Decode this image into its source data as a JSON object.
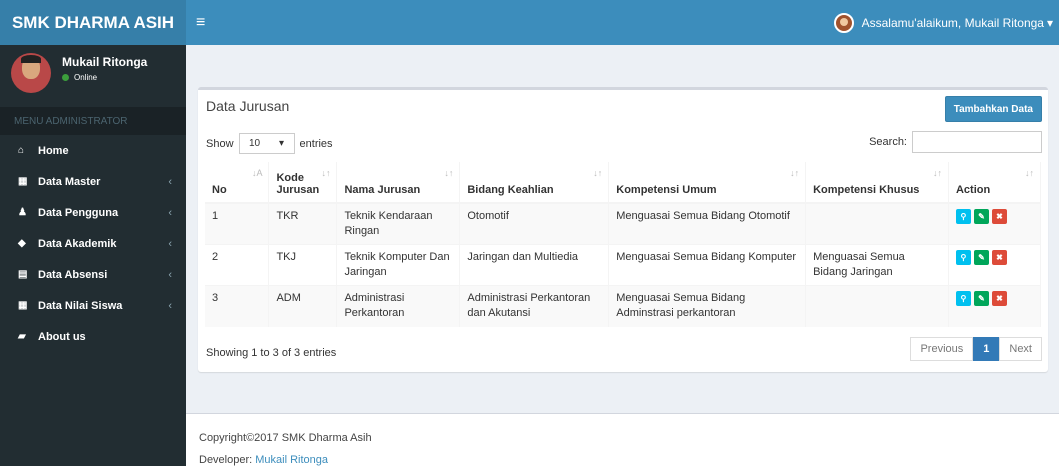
{
  "brand": "SMK DHARMA ASIH",
  "header": {
    "menu_icon": "hamburger-icon",
    "greeting": "Assalamu'alaikum, Mukail Ritonga",
    "caret": "▾"
  },
  "user": {
    "name": "Mukail Ritonga",
    "status": "Online"
  },
  "sidebar": {
    "header": "MENU ADMINISTRATOR",
    "items": [
      {
        "label": "Home",
        "icon": "home-icon",
        "glyph": "⌂",
        "chevron": ""
      },
      {
        "label": "Data Master",
        "icon": "grid-icon",
        "glyph": "▦",
        "chevron": "‹"
      },
      {
        "label": "Data Pengguna",
        "icon": "user-icon",
        "glyph": "♟",
        "chevron": "‹"
      },
      {
        "label": "Data Akademik",
        "icon": "tag-icon",
        "glyph": "◆",
        "chevron": "‹"
      },
      {
        "label": "Data Absensi",
        "icon": "calendar-icon",
        "glyph": "▤",
        "chevron": "‹"
      },
      {
        "label": "Data Nilai Siswa",
        "icon": "table-icon",
        "glyph": "▦",
        "chevron": "‹"
      },
      {
        "label": "About us",
        "icon": "book-icon",
        "glyph": "▰",
        "chevron": ""
      }
    ]
  },
  "box": {
    "title": "Data Jurusan",
    "add_button": "Tambahkan Data"
  },
  "table_controls": {
    "show": "Show",
    "length": "10",
    "entries": "entries",
    "search": "Search:"
  },
  "columns": [
    "No",
    "Kode Jurusan",
    "Nama Jurusan",
    "Bidang Keahlian",
    "Kompetensi Umum",
    "Kompetensi Khusus",
    "Action"
  ],
  "rows": [
    {
      "no": "1",
      "kode": "TKR",
      "nama": "Teknik Kendaraan Ringan",
      "bidang": "Otomotif",
      "umum": "Menguasai Semua Bidang Otomotif",
      "khusus": ""
    },
    {
      "no": "2",
      "kode": "TKJ",
      "nama": "Teknik Komputer Dan Jaringan",
      "bidang": "Jaringan dan Multiedia",
      "umum": "Menguasai Semua Bidang Komputer",
      "khusus": "Menguasai Semua Bidang Jaringan"
    },
    {
      "no": "3",
      "kode": "ADM",
      "nama": "Administrasi Perkantoran",
      "bidang": "Administrasi Perkantoran dan Akutansi",
      "umum": "Menguasai Semua Bidang Adminstrasi perkantoran",
      "khusus": ""
    }
  ],
  "info": "Showing 1 to 3 of 3 entries",
  "pager": {
    "prev": "Previous",
    "page": "1",
    "next": "Next"
  },
  "footer": {
    "copyright": "Copyright©2017 SMK Dharma Asih",
    "developer_label": "Developer:",
    "developer_name": "Mukail Ritonga"
  }
}
